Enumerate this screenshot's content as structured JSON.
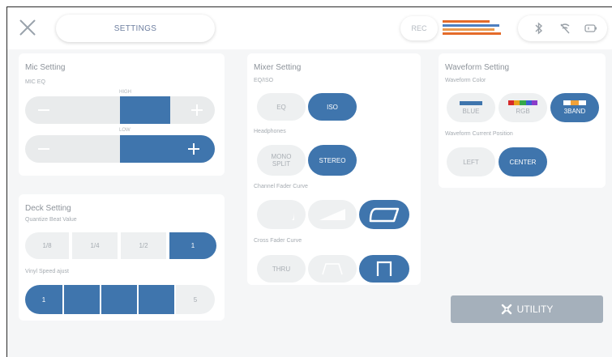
{
  "header": {
    "settings_tab": "SETTINGS",
    "rec_label": "REC",
    "status_icons": [
      "bluetooth-icon",
      "no-signal-icon",
      "battery-icon"
    ],
    "meter_colors": [
      "#e46b2a",
      "#4d7fc1",
      "#e99a50"
    ]
  },
  "mic": {
    "title": "Mic Setting",
    "eq_label": "MIC EQ",
    "high_label": "HIGH",
    "low_label": "LOW",
    "high_level": 0.5,
    "low_level": 1.0
  },
  "deck": {
    "title": "Deck Setting",
    "quantize_label": "Quantize Beat Value",
    "quantize_options": [
      "1/8",
      "1/4",
      "1/2",
      "1"
    ],
    "quantize_selected": "1",
    "vinyl_label": "Vinyl Speed ajust",
    "vinyl_min": "1",
    "vinyl_max": "5",
    "vinyl_level": 4
  },
  "mixer": {
    "title": "Mixer Setting",
    "eq_iso_label": "EQ/ISO",
    "eq_option": "EQ",
    "iso_option": "ISO",
    "eq_iso_selected": "ISO",
    "headphones_label": "Headphones",
    "mono_split": "MONO SPLIT",
    "stereo": "STEREO",
    "headphones_selected": "STEREO",
    "channel_fader_label": "Channel Fader Curve",
    "channel_fader_selected": 3,
    "cross_fader_label": "Cross Fader Curve",
    "cross_fader_thru": "THRU",
    "cross_fader_selected": 3
  },
  "waveform": {
    "title": "Waveform Setting",
    "color_label": "Waveform Color",
    "colors": [
      "BLUE",
      "RGB",
      "3BAND"
    ],
    "color_selected": "3BAND",
    "position_label": "Waveform Current Position",
    "positions": [
      "LEFT",
      "CENTER"
    ],
    "position_selected": "CENTER"
  },
  "utility": {
    "label": "UTILITY",
    "icon": "utility-icon"
  }
}
